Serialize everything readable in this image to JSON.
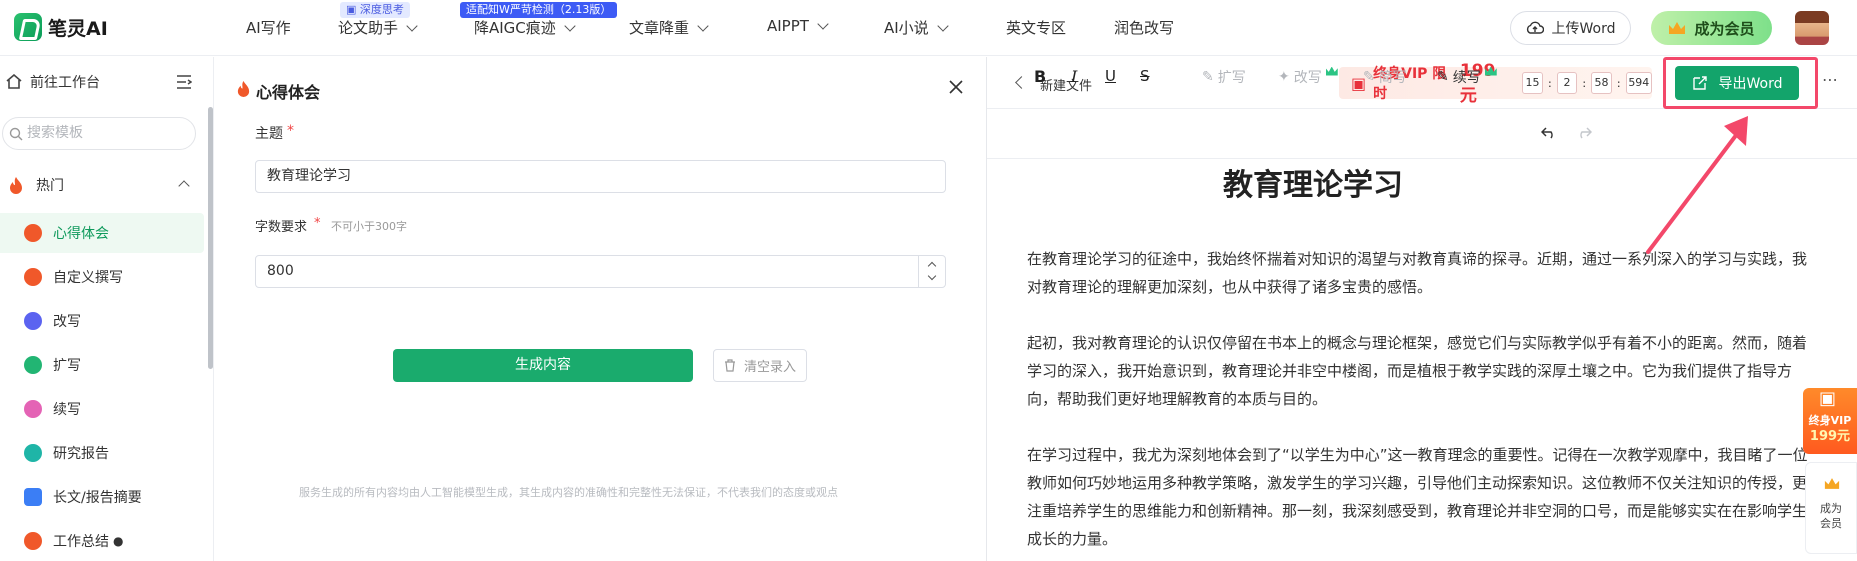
{
  "app": {
    "logo_text": "笔灵AI"
  },
  "nav": {
    "items": [
      "AI写作",
      "论文助手",
      "降AIGC痕迹",
      "文章降重",
      "AIPPT",
      "AI小说",
      "英文专区",
      "润色改写"
    ],
    "badge_deep": "深度思考",
    "badge_aigc": "适配知W严苛检测（2.13版）"
  },
  "header_actions": {
    "upload_label": "上传Word",
    "vip_label": "成为会员"
  },
  "sidebar": {
    "workspace_label": "前往工作台",
    "search_placeholder": "搜索模板",
    "group_label": "热门",
    "items": [
      {
        "label": "心得体会",
        "color": "#f0582a"
      },
      {
        "label": "自定义撰写",
        "color": "#f0582a"
      },
      {
        "label": "改写",
        "color": "#5b63f0"
      },
      {
        "label": "扩写",
        "color": "#22b573"
      },
      {
        "label": "续写",
        "color": "#e463b5"
      },
      {
        "label": "研究报告",
        "color": "#1fb5a7"
      },
      {
        "label": "长文/报告摘要",
        "color": "#3b7ef5"
      },
      {
        "label": "工作总结",
        "color": "#f0582a"
      }
    ]
  },
  "form": {
    "title": "心得体会",
    "topic_label": "主题",
    "required_mark": "*",
    "topic_value": "教育理论学习",
    "wordcount_label": "字数要求",
    "wordcount_hint": "不可小于300字",
    "wordcount_value": "800",
    "generate_label": "生成内容",
    "clear_label": "清空录入",
    "disclaimer": "服务生成的所有内容均由人工智能模型生成，其生成内容的准确性和完整性无法保证，不代表我们的态度或观点"
  },
  "editor": {
    "back_label": "新建文件",
    "promo_label": "终身VIP 限时",
    "promo_price": "199元",
    "timer": [
      "15",
      "2",
      "58",
      "594"
    ],
    "export_label": "导出Word",
    "tools": {
      "expand": "扩写",
      "rewrite": "改写",
      "shorten": "简写",
      "continue": "续写"
    },
    "doc_title": "教育理论学习",
    "paragraphs": [
      "在教育理论学习的征途中，我始终怀揣着对知识的渴望与对教育真谛的探寻。近期，通过一系列深入的学习与实践，我对教育理论的理解更加深刻，也从中获得了诸多宝贵的感悟。",
      "起初，我对教育理论的认识仅停留在书本上的概念与理论框架，感觉它们与实际教学似乎有着不小的距离。然而，随着学习的深入，我开始意识到，教育理论并非空中楼阁，而是植根于教学实践的深厚土壤之中。它为我们提供了指导方向，帮助我们更好地理解教育的本质与目的。",
      "在学习过程中，我尤为深刻地体会到了“以学生为中心”这一教育理念的重要性。记得在一次教学观摩中，我目睹了一位教师如何巧妙地运用多种教学策略，激发学生的学习兴趣，引导他们主动探索知识。这位教师不仅关注知识的传授，更注重培养学生的思维能力和创新精神。那一刻，我深刻感受到，教育理论并非空洞的口号，而是能够实实在在影响学生成长的力量。"
    ]
  },
  "floating": {
    "vip_line1": "终身VIP",
    "vip_line2": "199元",
    "member_label": "成为会员"
  },
  "colors": {
    "brand_green": "#1aab6d",
    "highlight": "#f3486a",
    "promo_red": "#e8313a"
  }
}
